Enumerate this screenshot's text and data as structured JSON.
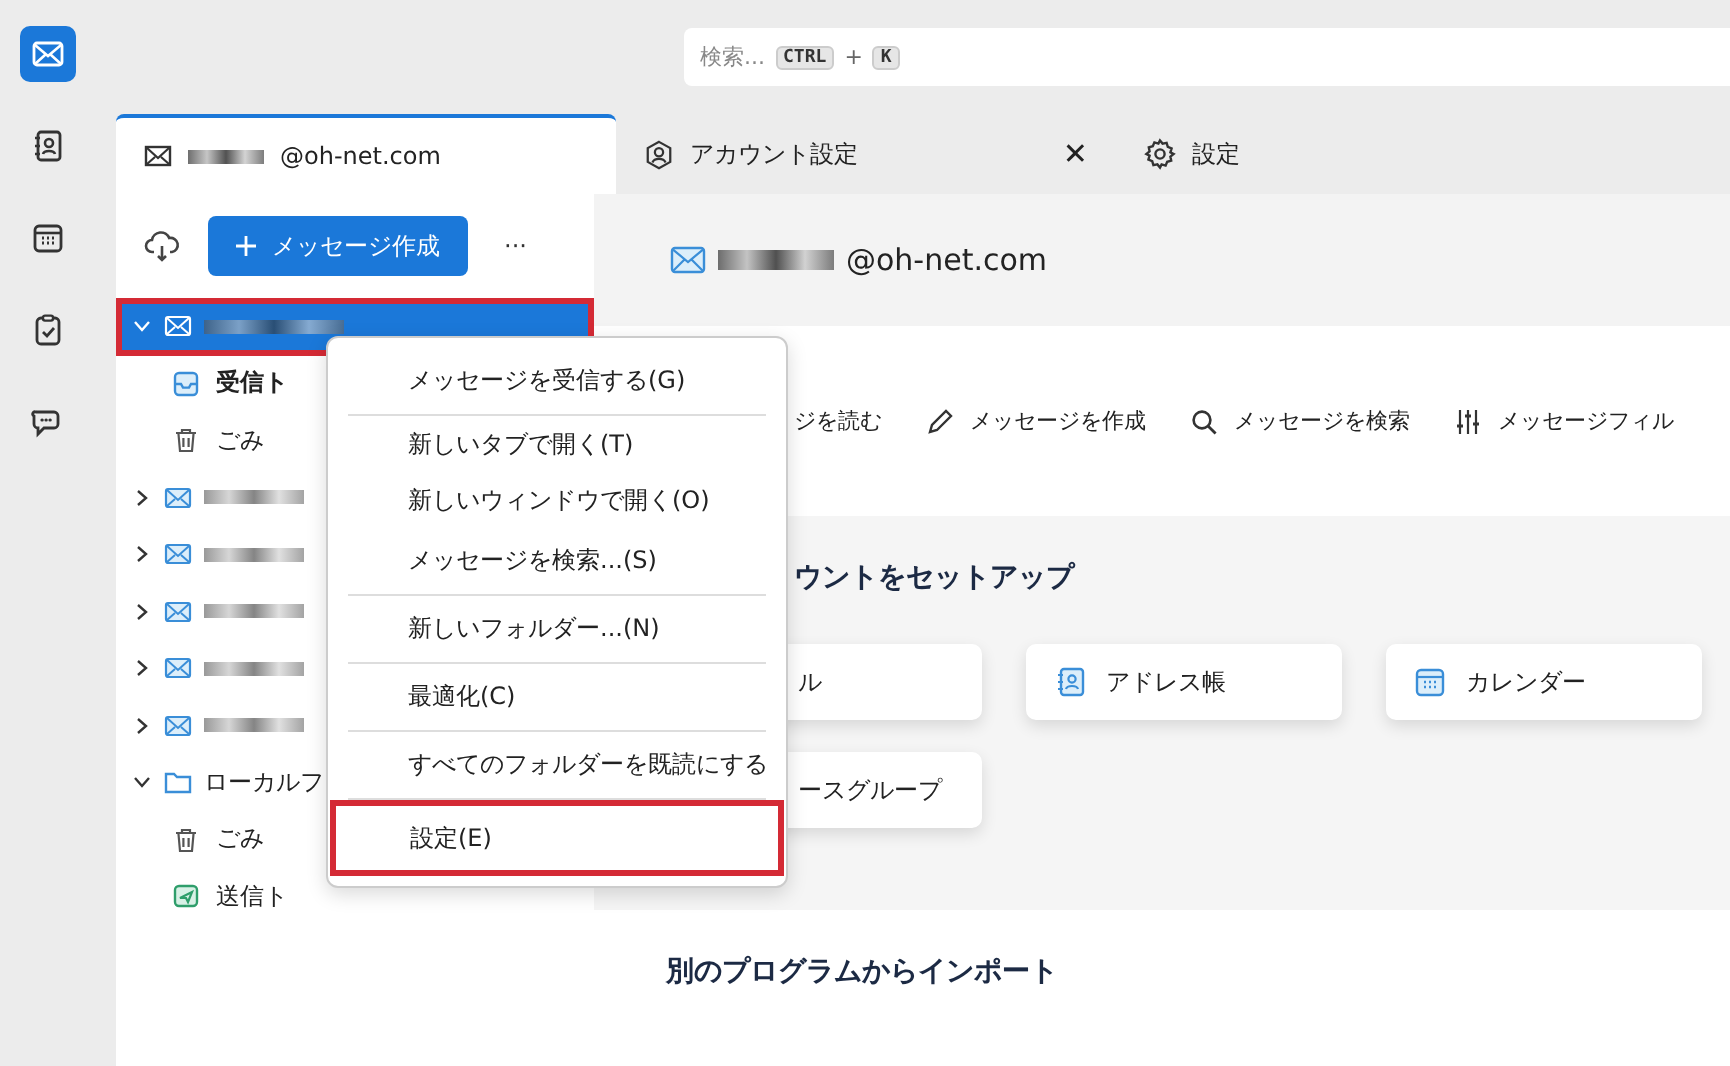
{
  "spaces": [
    {
      "kind": "mail",
      "selected": true
    },
    {
      "kind": "addressbook",
      "selected": false
    },
    {
      "kind": "calendar",
      "selected": false
    },
    {
      "kind": "tasks",
      "selected": false
    },
    {
      "kind": "chat",
      "selected": false
    }
  ],
  "search": {
    "placeholder": "検索...",
    "keys": [
      "CTRL",
      "+",
      "K"
    ]
  },
  "tabs": [
    {
      "kind": "mail",
      "label": "@oh-net.com",
      "selected": true
    },
    {
      "kind": "account",
      "label": "アカウント設定",
      "selected": false,
      "close": "✕"
    },
    {
      "kind": "settings",
      "label": "設定",
      "selected": false
    }
  ],
  "sidebar": {
    "compose_button": "メッセージ作成",
    "more": "···",
    "folders": [
      {
        "kind": "account",
        "expanded": true,
        "selected": true,
        "highlighted": true,
        "children": [
          {
            "kind": "inbox",
            "name": "受信ト",
            "bold": true
          },
          {
            "kind": "trash",
            "name": "ごみ",
            "bold": false
          }
        ]
      },
      {
        "kind": "account",
        "expanded": false,
        "selected": false,
        "highlighted": false
      },
      {
        "kind": "account",
        "expanded": false,
        "selected": false,
        "highlighted": false
      },
      {
        "kind": "account",
        "expanded": false,
        "selected": false,
        "highlighted": false
      },
      {
        "kind": "account",
        "expanded": false,
        "selected": false,
        "highlighted": false
      },
      {
        "kind": "account",
        "expanded": false,
        "selected": false,
        "highlighted": false
      },
      {
        "kind": "local",
        "name": "ローカルフ",
        "expanded": true,
        "selected": false,
        "highlighted": false,
        "children": [
          {
            "kind": "trash",
            "name": "ごみ",
            "bold": false
          },
          {
            "kind": "outbox",
            "name": "送信ト",
            "bold": false
          }
        ]
      }
    ]
  },
  "account_header": {
    "title": "@oh-net.com"
  },
  "actions": [
    {
      "kind": "read",
      "label": "ジを読む"
    },
    {
      "kind": "write",
      "label": "メッセージを作成"
    },
    {
      "kind": "search",
      "label": "メッセージを検索"
    },
    {
      "kind": "filter",
      "label": "メッセージフィル"
    }
  ],
  "setup": {
    "heading": "ウントをセットアップ",
    "cards": [
      {
        "kind": "mail",
        "label": "ル"
      },
      {
        "kind": "addressbook",
        "label": "アドレス帳"
      },
      {
        "kind": "calendar",
        "label": "カレンダー"
      },
      {
        "kind": "news",
        "label": "ースグループ"
      }
    ]
  },
  "import": {
    "heading": "別のプログラムからインポート"
  },
  "context_menu": [
    {
      "label": "メッセージを受信する(G)",
      "separator_after": true,
      "highlighted": false
    },
    {
      "label": "新しいタブで開く(T)",
      "separator_after": false,
      "highlighted": false
    },
    {
      "label": "新しいウィンドウで開く(O)",
      "separator_after": false,
      "highlighted": false
    },
    {
      "label": "メッセージを検索...(S)",
      "separator_after": true,
      "highlighted": false
    },
    {
      "label": "新しいフォルダー...(N)",
      "separator_after": true,
      "highlighted": false
    },
    {
      "label": "最適化(C)",
      "separator_after": true,
      "highlighted": false
    },
    {
      "label": "すべてのフォルダーを既読にする",
      "separator_after": true,
      "highlighted": false
    },
    {
      "label": "設定(E)",
      "separator_after": false,
      "highlighted": true
    }
  ]
}
